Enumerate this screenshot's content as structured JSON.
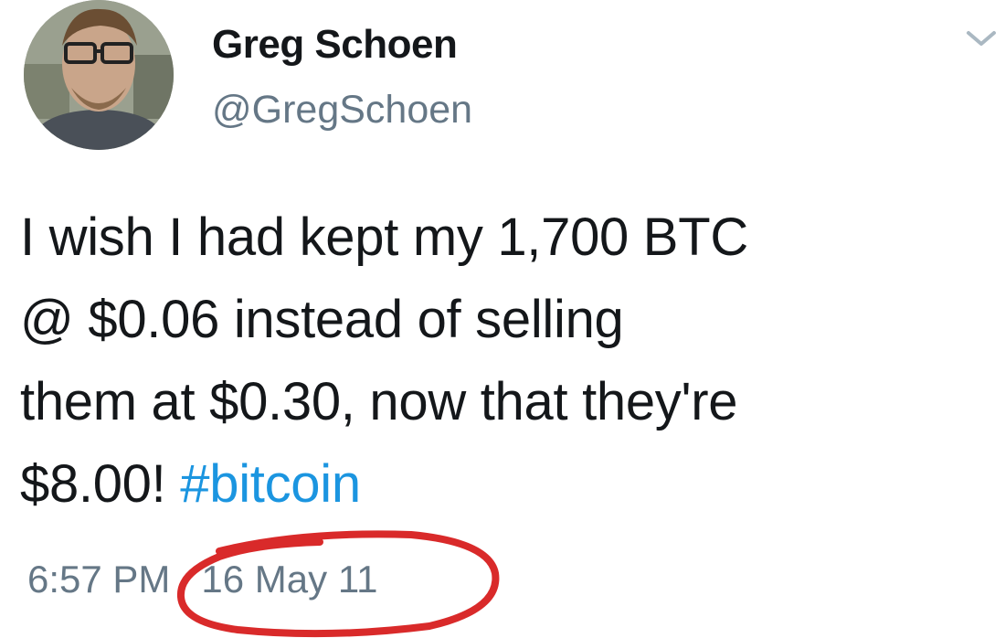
{
  "user": {
    "display_name": "Greg Schoen",
    "handle": "@GregSchoen",
    "avatar_icon": "user-photo-icon"
  },
  "menu": {
    "icon": "chevron-down-icon"
  },
  "tweet": {
    "line1": "I wish I had kept my 1,700 BTC",
    "line2": "@ $0.06 instead of selling",
    "line3": "them at $0.30, now that they're",
    "line4_text": "$8.00! ",
    "hashtag": "#bitcoin"
  },
  "meta": {
    "time": "6:57 PM",
    "separator": "·",
    "date": "16 May 11"
  },
  "colors": {
    "text": "#14171a",
    "secondary": "#657786",
    "hashtag": "#1b95e0",
    "annotation": "#d92a2a"
  }
}
